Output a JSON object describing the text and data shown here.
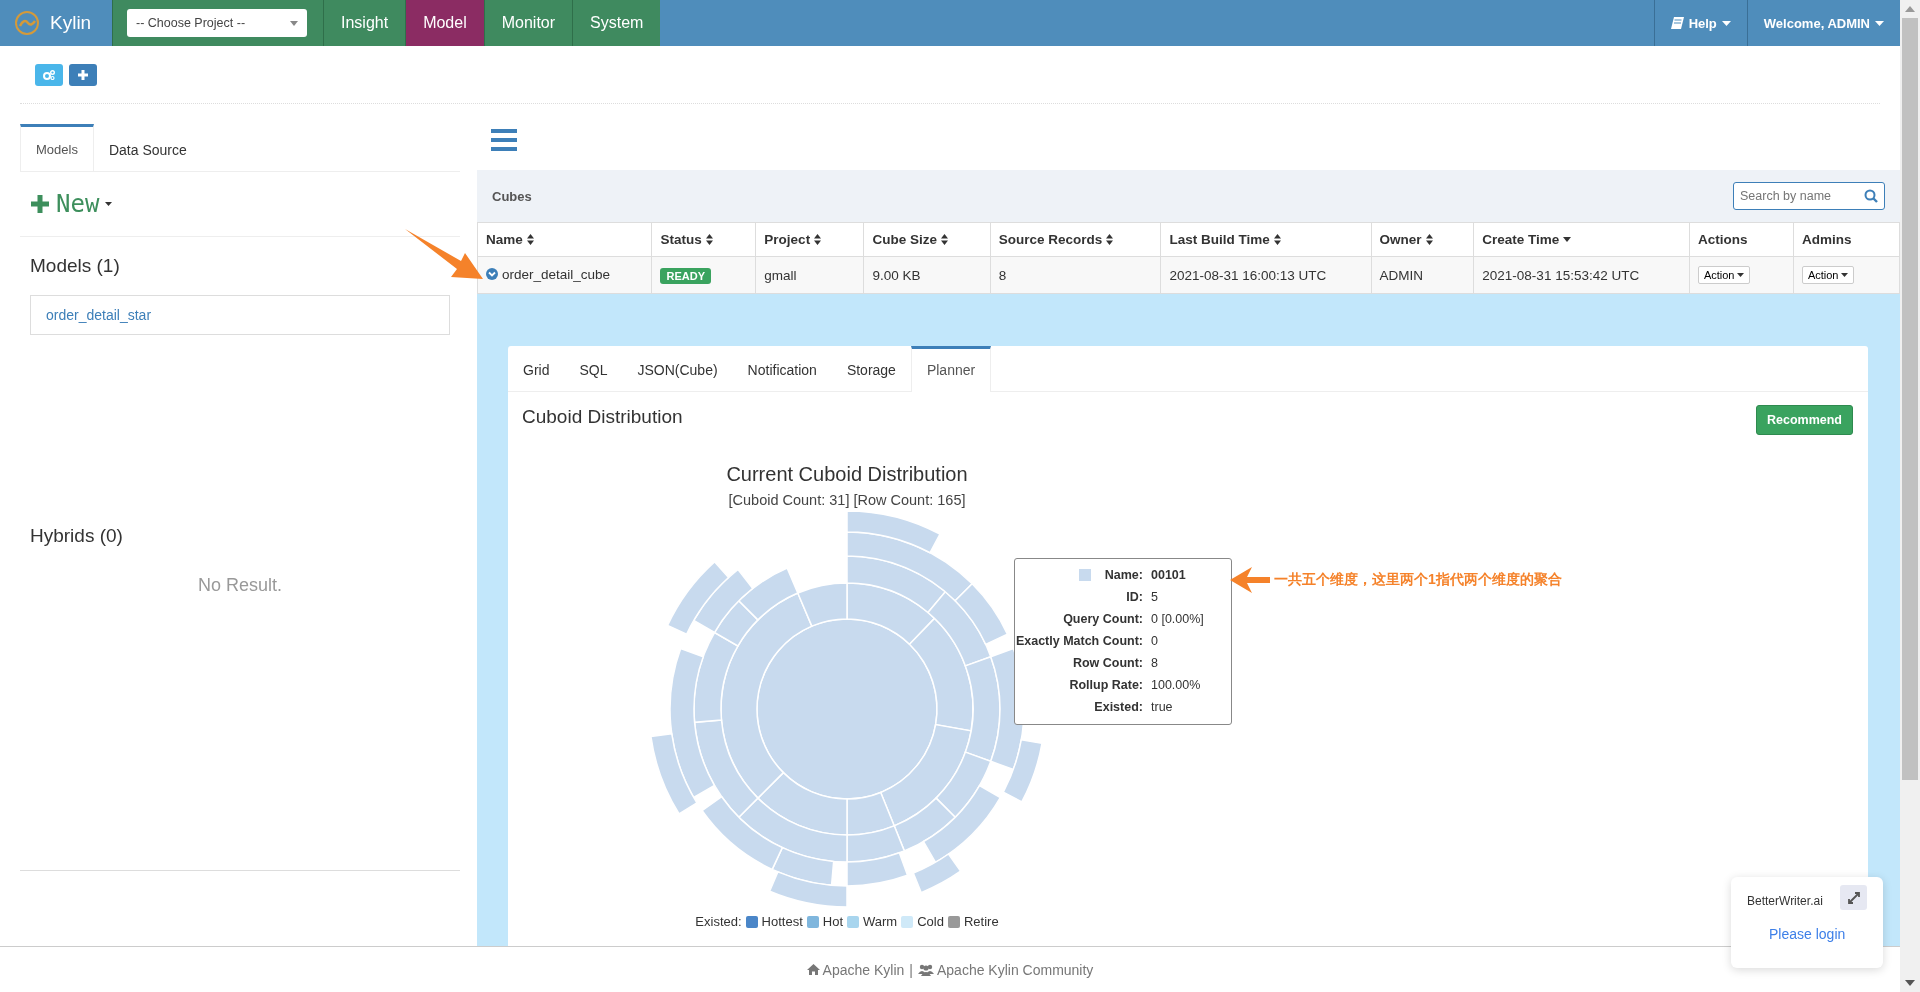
{
  "navbar": {
    "brand": "Kylin",
    "project_select": "-- Choose Project --",
    "tabs": [
      {
        "label": "Insight",
        "selected": false
      },
      {
        "label": "Model",
        "selected": true
      },
      {
        "label": "Monitor",
        "selected": false
      },
      {
        "label": "System",
        "selected": false
      }
    ],
    "help": "Help",
    "user": "Welcome, ADMIN"
  },
  "sidebar": {
    "tabs": [
      {
        "label": "Models",
        "selected": true
      },
      {
        "label": "Data Source",
        "selected": false
      }
    ],
    "new_button": "New",
    "models_heading": "Models (1)",
    "models": [
      "order_detail_star"
    ],
    "hybrids_heading": "Hybrids (0)",
    "hybrids_empty": "No Result."
  },
  "cubes": {
    "title": "Cubes",
    "search": {
      "placeholder": "Search by name"
    },
    "columns": [
      {
        "label": "Name",
        "sortable": true,
        "sorted": false
      },
      {
        "label": "Status",
        "sortable": true,
        "sorted": false
      },
      {
        "label": "Project",
        "sortable": true,
        "sorted": false
      },
      {
        "label": "Cube Size",
        "sortable": true,
        "sorted": false
      },
      {
        "label": "Source Records",
        "sortable": true,
        "sorted": false
      },
      {
        "label": "Last Build Time",
        "sortable": true,
        "sorted": false
      },
      {
        "label": "Owner",
        "sortable": true,
        "sorted": false
      },
      {
        "label": "Create Time",
        "sortable": true,
        "sorted": true
      },
      {
        "label": "Actions",
        "sortable": false
      },
      {
        "label": "Admins",
        "sortable": false
      }
    ],
    "rows": [
      {
        "expanded": true,
        "name": "order_detail_cube",
        "status": "READY",
        "project": "gmall",
        "cube_size": "9.00 KB",
        "source_records": "8",
        "last_build_time": "2021-08-31 16:00:13 UTC",
        "owner": "ADMIN",
        "create_time": "2021-08-31 15:53:42 UTC",
        "actions": "Action",
        "admins": "Action"
      }
    ]
  },
  "detail": {
    "tabs": [
      {
        "label": "Grid",
        "selected": false
      },
      {
        "label": "SQL",
        "selected": false
      },
      {
        "label": "JSON(Cube)",
        "selected": false
      },
      {
        "label": "Notification",
        "selected": false
      },
      {
        "label": "Storage",
        "selected": false
      },
      {
        "label": "Planner",
        "selected": true
      }
    ],
    "section_title": "Cuboid Distribution",
    "recommend_button": "Recommend",
    "chart": {
      "title": "Current Cuboid Distribution",
      "subtitle": "[Cuboid Count: 31] [Row Count: 165]",
      "tooltip": [
        {
          "label": "Name:",
          "value": "00101"
        },
        {
          "label": "ID:",
          "value": "5"
        },
        {
          "label": "Query Count:",
          "value": "0 [0.00%]"
        },
        {
          "label": "Exactly Match Count:",
          "value": "0"
        },
        {
          "label": "Row Count:",
          "value": "8"
        },
        {
          "label": "Rollup Rate:",
          "value": "100.00%"
        },
        {
          "label": "Existed:",
          "value": "true"
        }
      ],
      "legend_label": "Existed:",
      "legend": [
        {
          "label": "Hottest",
          "color": "#4a86c8"
        },
        {
          "label": "Hot",
          "color": "#7fb6dd"
        },
        {
          "label": "Warm",
          "color": "#a8d5ee"
        },
        {
          "label": "Cold",
          "color": "#cfe9f8"
        },
        {
          "label": "Retire",
          "color": "#999999"
        }
      ]
    }
  },
  "annotation": {
    "note": "一共五个维度，这里两个1指代两个维度的聚合"
  },
  "footer": {
    "links": [
      "Apache Kylin",
      "Apache Kylin Community"
    ],
    "separator": "|"
  },
  "widget": {
    "title": "BetterWriter.ai",
    "link": "Please login"
  }
}
